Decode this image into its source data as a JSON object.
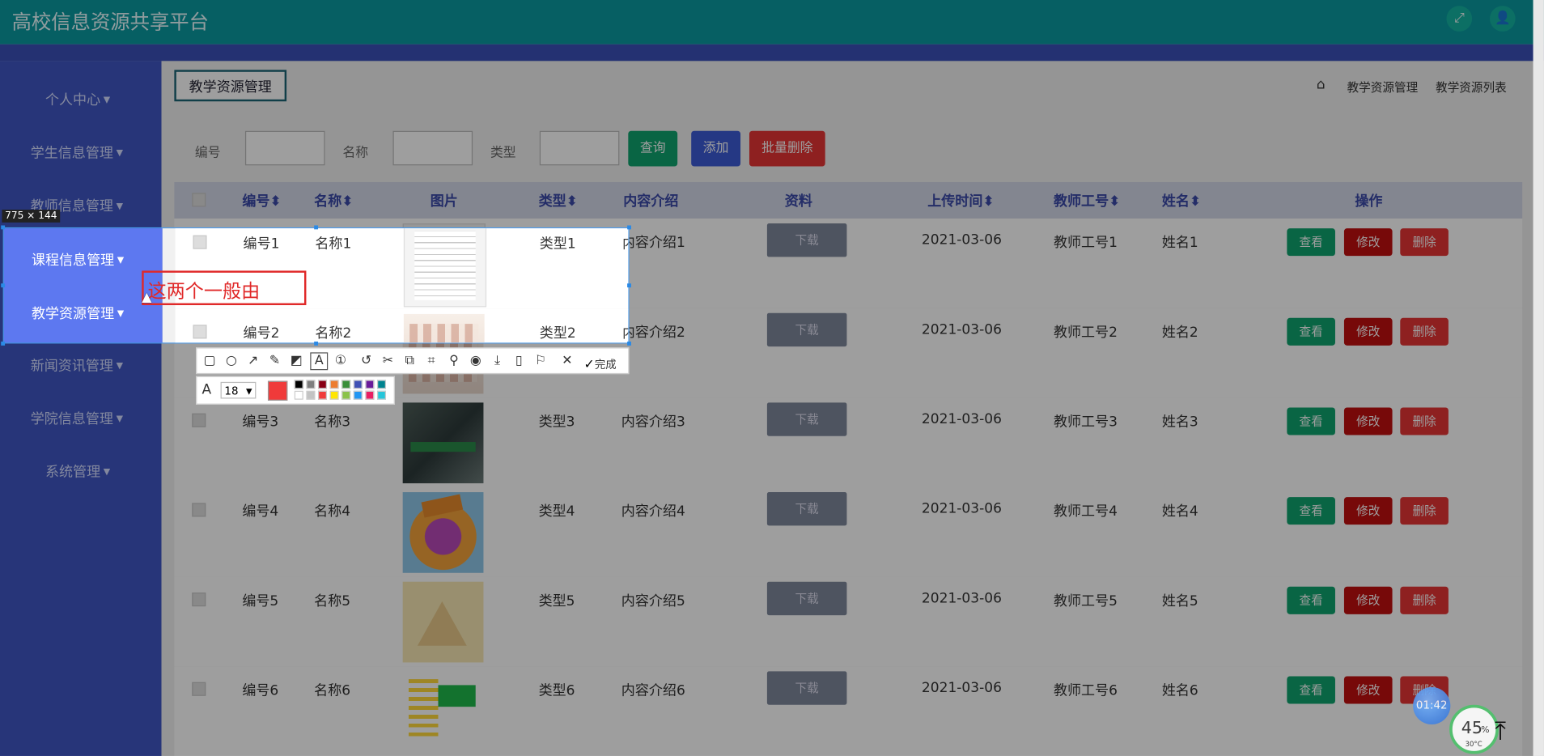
{
  "app": {
    "title": "高校信息资源共享平台"
  },
  "sidebar": {
    "items": [
      {
        "label": "个人中心"
      },
      {
        "label": "学生信息管理"
      },
      {
        "label": "教师信息管理"
      },
      {
        "label": "课程信息管理"
      },
      {
        "label": "教学资源管理"
      },
      {
        "label": "新闻资讯管理"
      },
      {
        "label": "学院信息管理"
      },
      {
        "label": "系统管理"
      }
    ]
  },
  "page": {
    "title": "教学资源管理",
    "breadcrumbs": [
      "教学资源管理",
      "教学资源列表"
    ]
  },
  "filters": {
    "number_label": "编号",
    "name_label": "名称",
    "type_label": "类型"
  },
  "buttons": {
    "search": "查询",
    "add": "添加",
    "batch_delete": "批量删除"
  },
  "table": {
    "headers": [
      "编号",
      "名称",
      "图片",
      "类型",
      "内容介绍",
      "资料",
      "上传时间",
      "教师工号",
      "姓名",
      "操作"
    ],
    "download_label": "下载",
    "actions": {
      "view": "查看",
      "edit": "修改",
      "delete": "删除"
    },
    "rows": [
      {
        "number": "编号1",
        "name": "名称1",
        "type": "类型1",
        "intro": "内容介绍1",
        "time": "2021-03-06",
        "teacher_id": "教师工号1",
        "teacher_name": "姓名1"
      },
      {
        "number": "编号2",
        "name": "名称2",
        "type": "类型2",
        "intro": "内容介绍2",
        "time": "2021-03-06",
        "teacher_id": "教师工号2",
        "teacher_name": "姓名2"
      },
      {
        "number": "编号3",
        "name": "名称3",
        "type": "类型3",
        "intro": "内容介绍3",
        "time": "2021-03-06",
        "teacher_id": "教师工号3",
        "teacher_name": "姓名3"
      },
      {
        "number": "编号4",
        "name": "名称4",
        "type": "类型4",
        "intro": "内容介绍4",
        "time": "2021-03-06",
        "teacher_id": "教师工号4",
        "teacher_name": "姓名4"
      },
      {
        "number": "编号5",
        "name": "名称5",
        "type": "类型5",
        "intro": "内容介绍5",
        "time": "2021-03-06",
        "teacher_id": "教师工号5",
        "teacher_name": "姓名5"
      },
      {
        "number": "编号6",
        "name": "名称6",
        "type": "类型6",
        "intro": "内容介绍6",
        "time": "2021-03-06",
        "teacher_id": "教师工号6",
        "teacher_name": "姓名6"
      }
    ]
  },
  "capture": {
    "size_label": "775 × 144",
    "annotation_text": "这两个一般由",
    "done_label": "完成",
    "font_size": "18",
    "selected_color": "#f03a3a"
  },
  "widgets": {
    "timer": "01:42",
    "battery_percent": "45",
    "percent_sign": "%",
    "temperature": "30°C"
  },
  "colors": {
    "header": "#0b9aa1",
    "sidebar": "#3f56c3",
    "search_btn": "#10a36e",
    "add_btn": "#3d5bd6",
    "danger": "#e53535",
    "edit_btn": "#c10f0f"
  }
}
